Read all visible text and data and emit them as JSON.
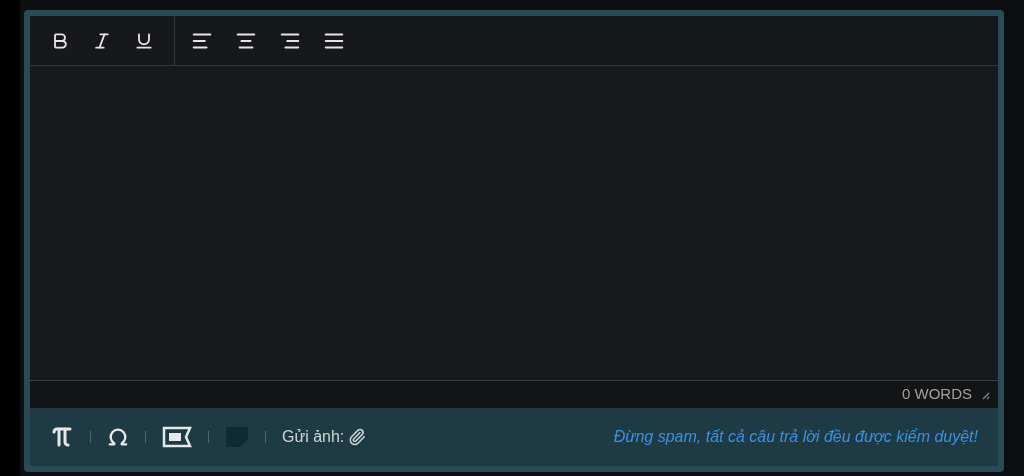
{
  "toolbar": {
    "format_buttons": [
      {
        "kind": "bold"
      },
      {
        "kind": "italic"
      },
      {
        "kind": "underline"
      }
    ],
    "align_buttons": [
      {
        "kind": "left"
      },
      {
        "kind": "center"
      },
      {
        "kind": "right"
      },
      {
        "kind": "justify"
      }
    ]
  },
  "editor": {
    "word_count": "0 WORDS"
  },
  "footer": {
    "tools": [
      {
        "kind": "pi",
        "disabled": false
      },
      {
        "kind": "omega",
        "disabled": false
      },
      {
        "kind": "language",
        "disabled": false
      },
      {
        "kind": "sticker",
        "disabled": true
      }
    ],
    "attach_label": "Gửi ảnh:",
    "notice": "Đừng spam, tất cả câu trả lời đều được kiểm duyệt!"
  }
}
